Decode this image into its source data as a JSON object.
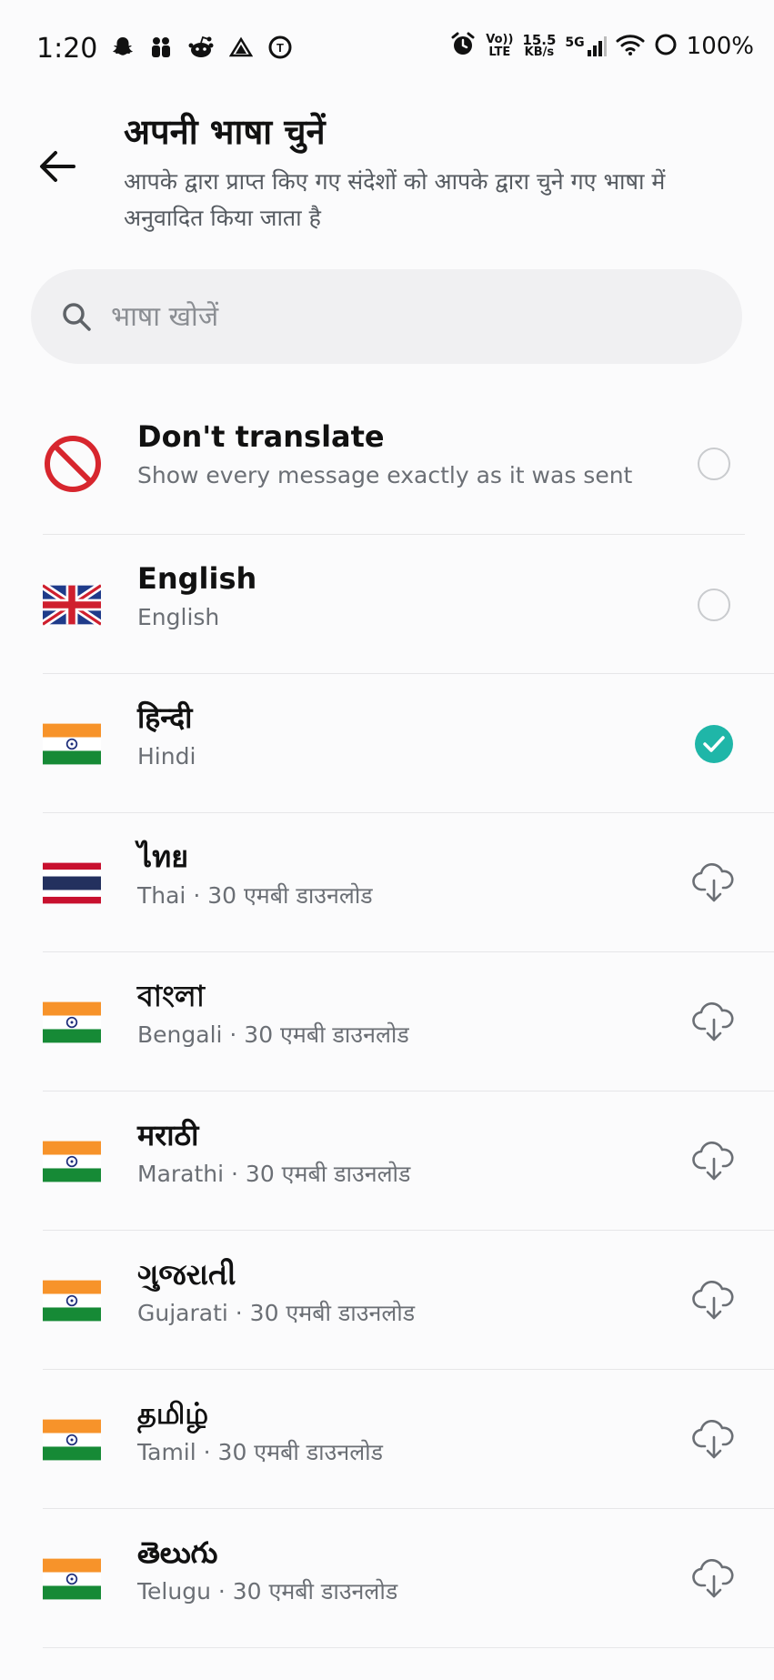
{
  "status_bar": {
    "time": "1:20",
    "volte_top": "Vo))",
    "volte_bottom": "LTE",
    "speed_value": "15.5",
    "speed_unit": "KB/s",
    "network": "5G",
    "battery": "100%"
  },
  "header": {
    "title": "अपनी भाषा चुनें",
    "subtitle": "आपके द्वारा प्राप्त किए गए संदेशों को आपके द्वारा चुने गए भाषा में अनुवादित किया जाता है"
  },
  "search": {
    "placeholder": "भाषा खोजें",
    "value": ""
  },
  "languages": [
    {
      "name": "Don't translate",
      "sub": "Show every message exactly as it was sent",
      "flag": "no-symbol-icon",
      "state": "unselected"
    },
    {
      "name": "English",
      "sub": "English",
      "flag": "uk-flag-icon",
      "state": "unselected"
    },
    {
      "name": "हिन्दी",
      "sub": "Hindi",
      "flag": "india-flag-icon",
      "state": "selected"
    },
    {
      "name": "ไทย",
      "sub": "Thai · 30 एमबी डाउनलोड",
      "flag": "thailand-flag-icon",
      "state": "download"
    },
    {
      "name": "বাংলা",
      "sub": "Bengali · 30 एमबी डाउनलोड",
      "flag": "india-flag-icon",
      "state": "download"
    },
    {
      "name": "मराठी",
      "sub": "Marathi · 30 एमबी डाउनलोड",
      "flag": "india-flag-icon",
      "state": "download"
    },
    {
      "name": "ગુજરાતી",
      "sub": "Gujarati · 30 एमबी डाउनलोड",
      "flag": "india-flag-icon",
      "state": "download"
    },
    {
      "name": "தமிழ்",
      "sub": "Tamil · 30 एमबी डाउनलोड",
      "flag": "india-flag-icon",
      "state": "download"
    },
    {
      "name": "తెలుగు",
      "sub": "Telugu · 30 एमबी डाउनलोड",
      "flag": "india-flag-icon",
      "state": "download"
    }
  ],
  "colors": {
    "accent": "#1fb6a8",
    "no_symbol": "#d7262e",
    "background": "#fbfbfc",
    "search_bg": "#f0f0f2"
  }
}
